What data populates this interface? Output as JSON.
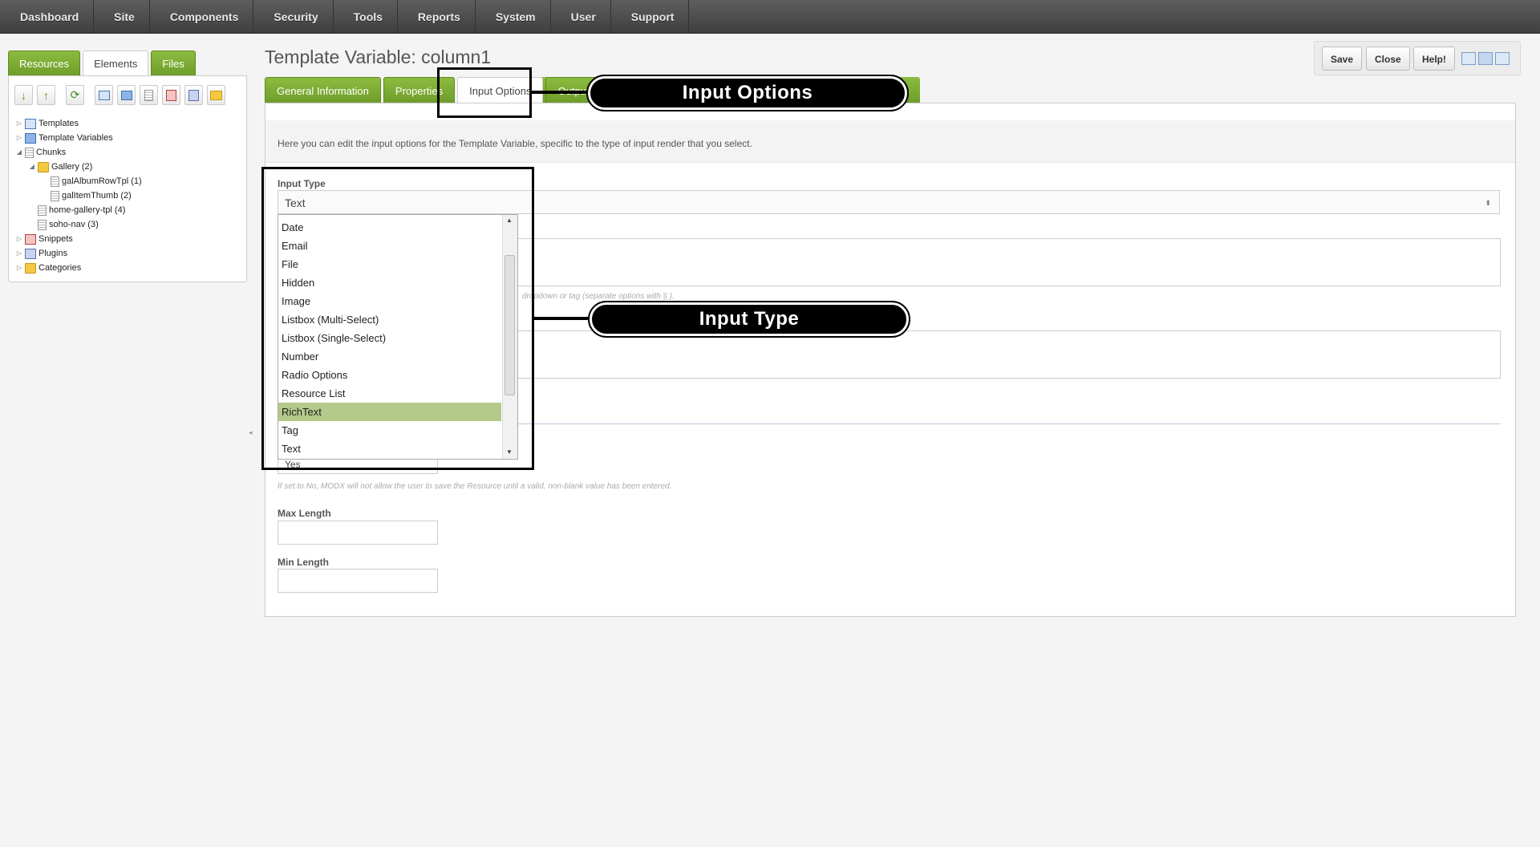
{
  "topnav": {
    "items": [
      "Dashboard",
      "Site",
      "Components",
      "Security",
      "Tools",
      "Reports",
      "System",
      "User",
      "Support"
    ]
  },
  "left": {
    "tabs": [
      "Resources",
      "Elements",
      "Files"
    ],
    "active_tab": "Elements",
    "tree": [
      {
        "label": "Templates",
        "icon": "template-icon"
      },
      {
        "label": "Template Variables",
        "icon": "template-variable-icon"
      },
      {
        "label": "Chunks",
        "icon": "chunk-icon"
      },
      {
        "label": "Gallery (2)",
        "icon": "folder-icon"
      },
      {
        "label": "galAlbumRowTpl (1)",
        "icon": "chunk-icon"
      },
      {
        "label": "galItemThumb (2)",
        "icon": "chunk-icon"
      },
      {
        "label": "home-gallery-tpl (4)",
        "icon": "chunk-icon"
      },
      {
        "label": "soho-nav (3)",
        "icon": "chunk-icon"
      },
      {
        "label": "Snippets",
        "icon": "snippet-icon"
      },
      {
        "label": "Plugins",
        "icon": "plugin-icon"
      },
      {
        "label": "Categories",
        "icon": "folder-icon"
      }
    ]
  },
  "main": {
    "title": "Template Variable: column1",
    "actions": {
      "save": "Save",
      "close": "Close",
      "help": "Help!"
    },
    "tabs": [
      "General Information",
      "Properties",
      "Input Options",
      "Output Opt"
    ],
    "active_tab": "Input Options",
    "description": "Here you can edit the input options for the Template Variable, specific to the type of input render that you select.",
    "input_type_label": "Input Type",
    "input_type_value": "Text",
    "options_hint": "dropdown or tag (separate options with || ).",
    "allow_blank_value": "Yes",
    "allow_blank_hint": "If set to No, MODX will not allow the user to save the Resource until a valid, non-blank value has been entered.",
    "max_length_label": "Max Length",
    "min_length_label": "Min Length",
    "dropdown_options": [
      "Date",
      "Email",
      "File",
      "Hidden",
      "Image",
      "Listbox (Multi-Select)",
      "Listbox (Single-Select)",
      "Number",
      "Radio Options",
      "Resource List",
      "RichText",
      "Tag",
      "Text"
    ],
    "dropdown_selected": "RichText"
  },
  "callouts": {
    "input_options": "Input Options",
    "input_type": "Input Type"
  },
  "colors": {
    "tab_green": "#7aab32",
    "selected_option": "#b5c98a",
    "nav_dark": "#4a4a4a"
  }
}
